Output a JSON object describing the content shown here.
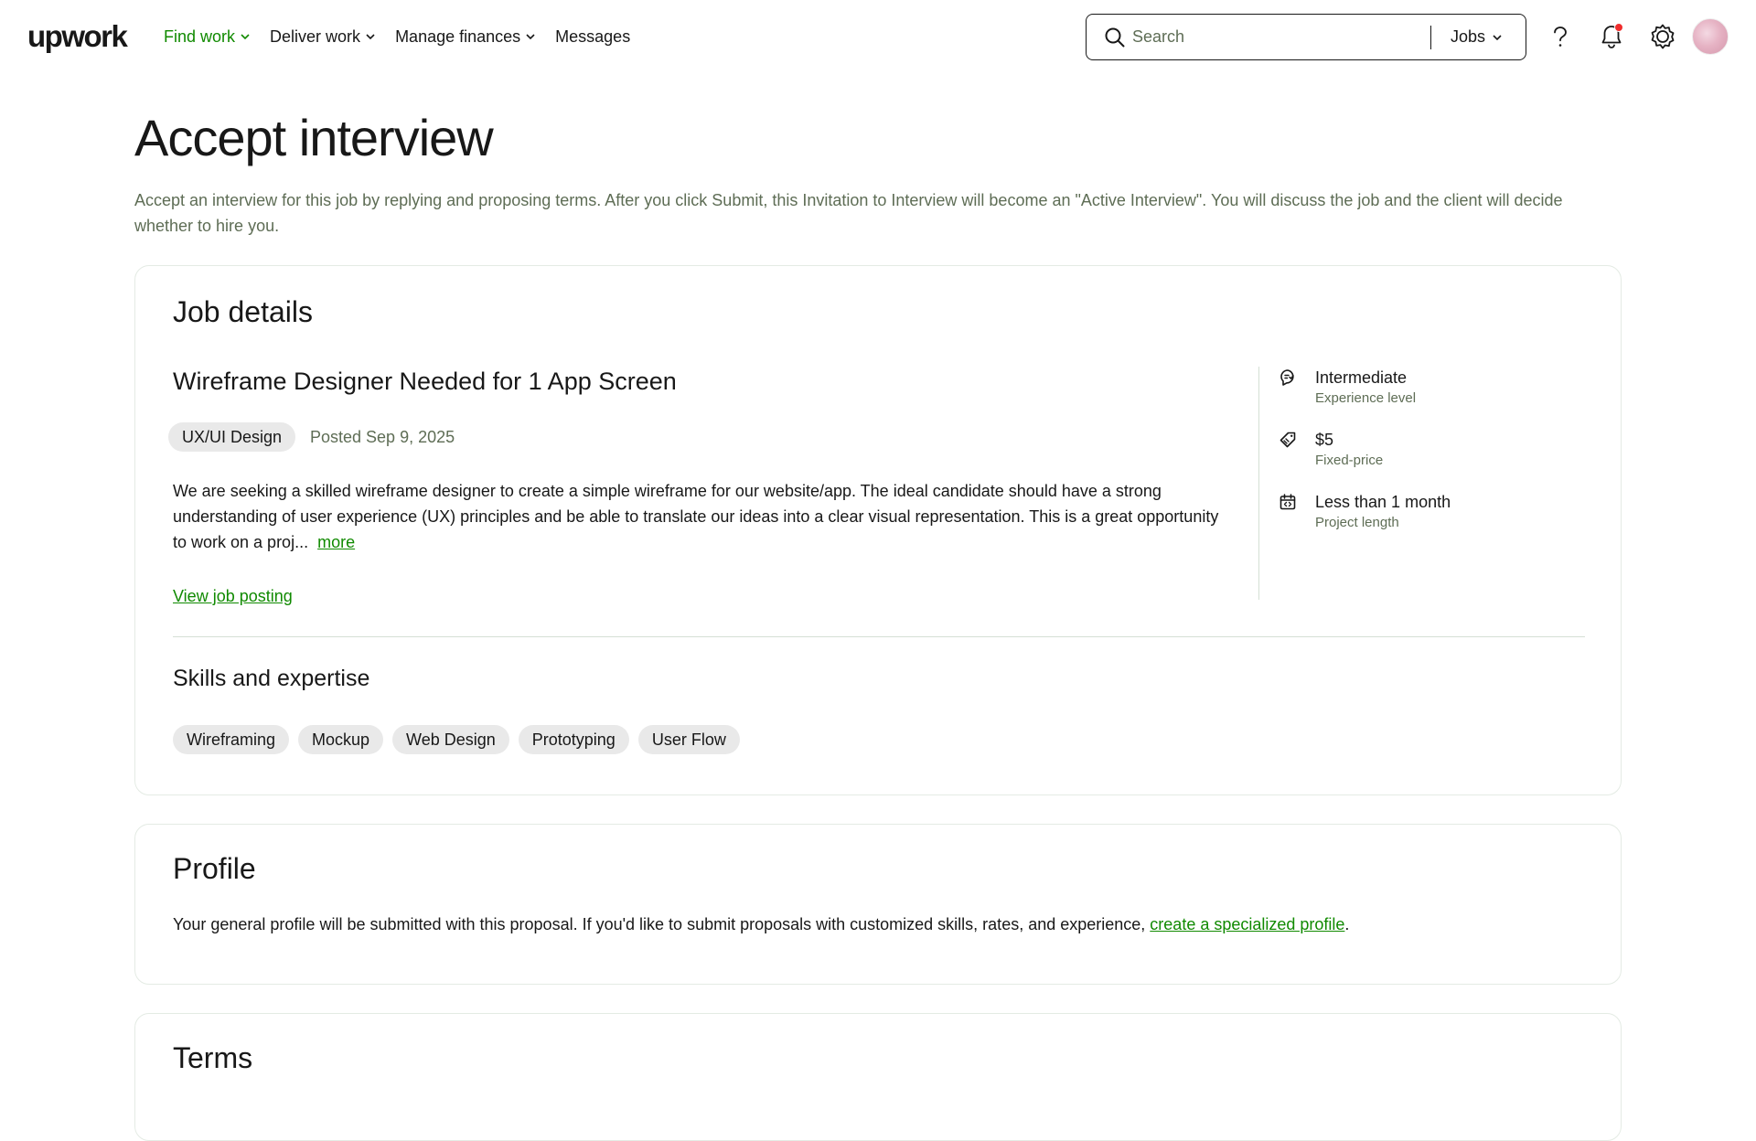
{
  "header": {
    "logo": "upwork",
    "nav": [
      {
        "label": "Find work",
        "active": true,
        "dropdown": true
      },
      {
        "label": "Deliver work",
        "active": false,
        "dropdown": true
      },
      {
        "label": "Manage finances",
        "active": false,
        "dropdown": true
      },
      {
        "label": "Messages",
        "active": false,
        "dropdown": false
      }
    ],
    "search": {
      "placeholder": "Search",
      "scope": "Jobs"
    },
    "icons": [
      "help-icon",
      "notification-bell-icon",
      "settings-icon",
      "avatar"
    ]
  },
  "page": {
    "title": "Accept interview",
    "description": "Accept an interview for this job by replying and proposing terms. After you click Submit, this Invitation to Interview will become an \"Active Interview\". You will discuss the job and the client will decide whether to hire you."
  },
  "job_details": {
    "section_title": "Job details",
    "job_title": "Wireframe Designer Needed for 1 App Screen",
    "category": "UX/UI Design",
    "posted": "Posted Sep 9, 2025",
    "description": "We are seeking a skilled wireframe designer to create a simple wireframe for our website/app. The ideal candidate should have a strong understanding of user experience (UX) principles and be able to translate our ideas into a clear visual representation. This is a great opportunity to work on a proj...",
    "more_label": "more",
    "view_link": "View job posting",
    "meta": [
      {
        "icon": "experience-level-icon",
        "value": "Intermediate",
        "label": "Experience level"
      },
      {
        "icon": "price-tag-icon",
        "value": "$5",
        "label": "Fixed-price"
      },
      {
        "icon": "calendar-icon",
        "value": "Less than 1 month",
        "label": "Project length"
      }
    ],
    "skills_title": "Skills and expertise",
    "skills": [
      "Wireframing",
      "Mockup",
      "Web Design",
      "Prototyping",
      "User Flow"
    ]
  },
  "profile": {
    "section_title": "Profile",
    "text_before": "Your general profile will be submitted with this proposal. If you'd like to submit proposals with customized skills, rates, and experience, ",
    "link": "create a specialized profile",
    "text_after": "."
  },
  "terms": {
    "section_title": "Terms"
  },
  "colors": {
    "accent_green": "#108a00",
    "muted_text": "#5e6d55",
    "chip_bg": "#e9e9e9",
    "notification_dot": "#f02d2d"
  }
}
